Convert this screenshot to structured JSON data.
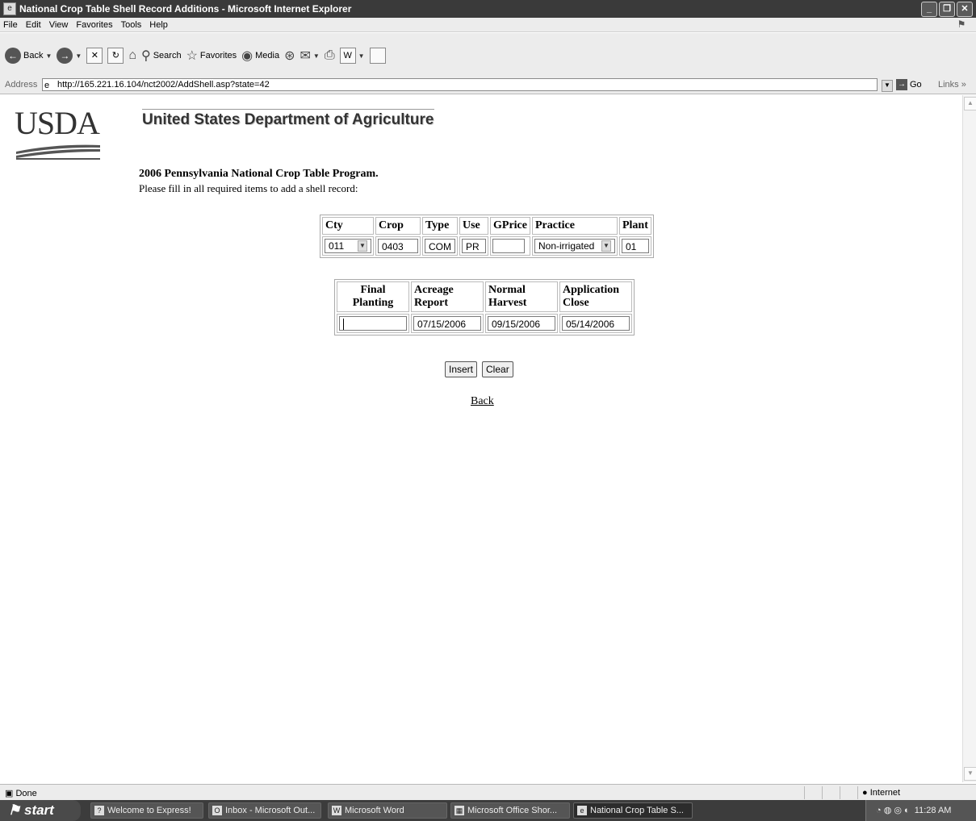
{
  "window": {
    "title": "National Crop Table Shell Record Additions - Microsoft Internet Explorer"
  },
  "menu": [
    "File",
    "Edit",
    "View",
    "Favorites",
    "Tools",
    "Help"
  ],
  "toolbar": {
    "back": "Back",
    "search": "Search",
    "favorites": "Favorites",
    "media": "Media"
  },
  "address": {
    "label": "Address",
    "url": "http://165.221.16.104/nct2002/AddShell.asp?state=42",
    "go": "Go",
    "links": "Links"
  },
  "page": {
    "logo_text": "USDA",
    "agency": "United States Department of Agriculture",
    "program_title": "2006 Pennsylvania National Crop Table Program.",
    "instructions": "Please fill in all required items to add a shell record:",
    "table1": {
      "headers": [
        "Cty",
        "Crop",
        "Type",
        "Use",
        "GPrice",
        "Practice",
        "Plant"
      ],
      "cty": "011",
      "crop": "0403",
      "type": "COM",
      "use": "PR",
      "gprice": "",
      "practice": "Non-irrigated",
      "plant": "01"
    },
    "table2": {
      "headers": [
        {
          "line1": "Final",
          "line2": "Planting"
        },
        {
          "line1": "Acreage",
          "line2": "Report"
        },
        {
          "line1": "Normal",
          "line2": "Harvest"
        },
        {
          "line1": "Application",
          "line2": "Close"
        }
      ],
      "final_planting": "",
      "acreage_report": "07/15/2006",
      "normal_harvest": "09/15/2006",
      "application_close": "05/14/2006"
    },
    "insert_label": "Insert",
    "clear_label": "Clear",
    "back_label": "Back"
  },
  "status": {
    "text": "Done",
    "zone": "Internet"
  },
  "taskbar": {
    "start": "start",
    "tasks": [
      "Welcome to Express!",
      "Inbox - Microsoft Out...",
      "Microsoft Word",
      "Microsoft Office Shor...",
      "National Crop Table S..."
    ],
    "clock": "11:28 AM"
  }
}
